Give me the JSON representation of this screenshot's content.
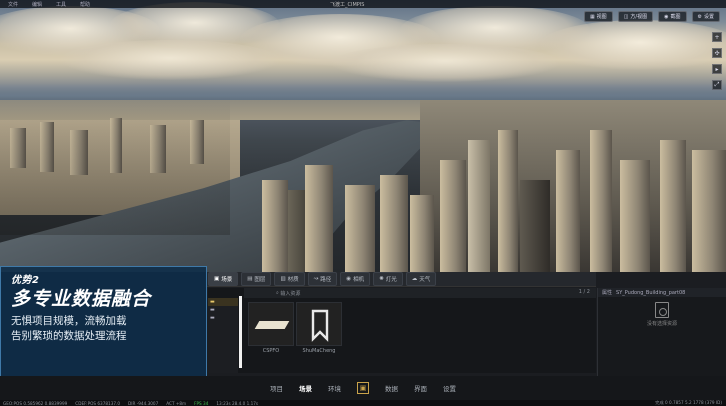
{
  "window": {
    "title": "飞渡工_CIMPIS",
    "menu": [
      "文件",
      "编辑",
      "工具",
      "帮助"
    ]
  },
  "top_tools": [
    {
      "icon": "grid-icon",
      "label": "视图"
    },
    {
      "icon": "layers-icon",
      "label": "方/视图"
    },
    {
      "icon": "camera-icon",
      "label": "截图"
    },
    {
      "icon": "gear-icon",
      "label": "设置"
    }
  ],
  "side_tools": [
    "plus-icon",
    "compass-icon",
    "play-icon",
    "expand-icon"
  ],
  "panel_tabs": [
    {
      "icon": "cube-icon",
      "label": "场景",
      "active": true
    },
    {
      "icon": "image-icon",
      "label": "图层"
    },
    {
      "icon": "texture-icon",
      "label": "材质"
    },
    {
      "icon": "path-icon",
      "label": "路径"
    },
    {
      "icon": "camera-icon",
      "label": "相机"
    },
    {
      "icon": "light-icon",
      "label": "灯光"
    },
    {
      "icon": "weather-icon",
      "label": "天气"
    }
  ],
  "filter": {
    "placeholder": "输入资源",
    "pager": "1 / 2"
  },
  "folders": [
    {
      "label": "",
      "selected": true
    },
    {
      "label": ""
    },
    {
      "label": ""
    }
  ],
  "assets": [
    {
      "label": "CSPFO"
    },
    {
      "label": "ShuMaCheng"
    }
  ],
  "right_panel": {
    "header": "属性",
    "path": "SY_Pudong_Building_part08",
    "empty_text": "没有选择资源"
  },
  "promo": {
    "tag": "优势2",
    "title": "多专业数据融合",
    "desc_line1": "无惧项目规模，流畅加载",
    "desc_line2": "告别繁琐的数据处理流程"
  },
  "bottom_nav": [
    {
      "label": "项目"
    },
    {
      "label": "场景",
      "active": true
    },
    {
      "label": "环境"
    },
    {
      "label": "数据"
    },
    {
      "label": "界面"
    },
    {
      "label": "设置"
    }
  ],
  "statusbar": {
    "geo": "GEO:POS  0.585962 0.8839999",
    "cdef": "CDEF:POS  6378137.0",
    "dir": "DIR  -944.3007",
    "act": "ACT  +8m",
    "fps": "FPS  34",
    "time": "13:23s  28.4.0 1.17s",
    "right": "完成 0  0.7857    5.2 1778 (379 ID)"
  },
  "colors": {
    "promo_bg": "#0e2e4a",
    "accent": "#c9a34a"
  }
}
